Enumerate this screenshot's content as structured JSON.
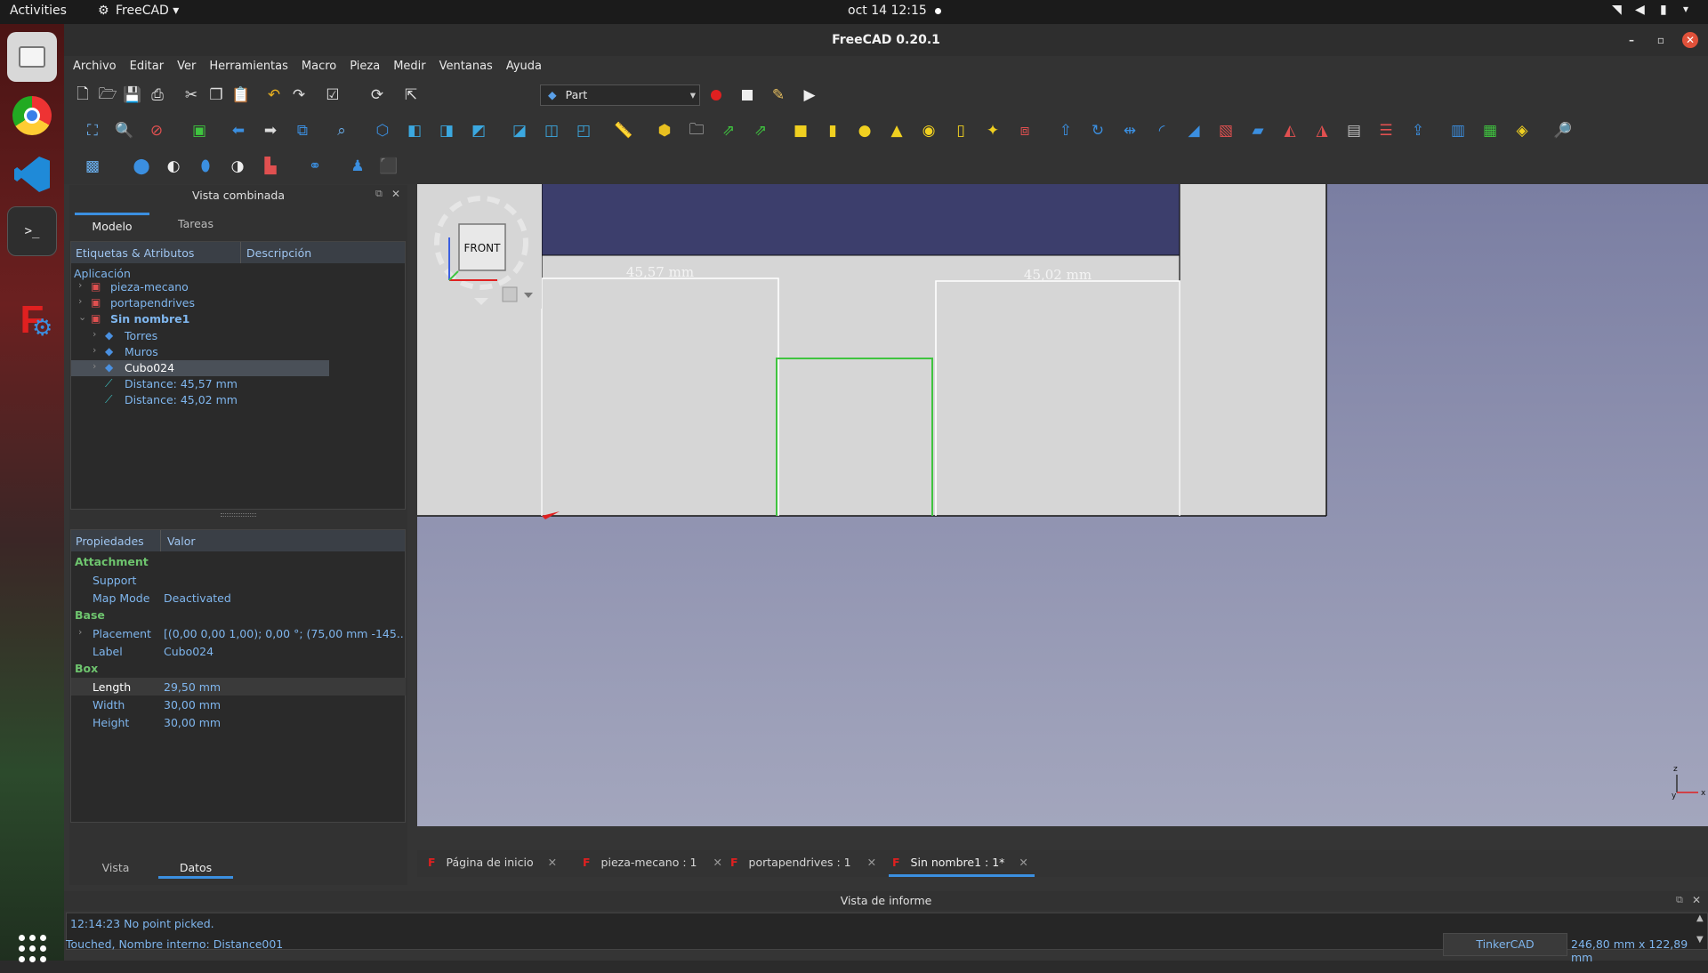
{
  "topbar": {
    "activities": "Activities",
    "app": "FreeCAD ▾",
    "clock": "oct 14  12:15"
  },
  "window": {
    "title": "FreeCAD 0.20.1"
  },
  "menu": [
    "Archivo",
    "Editar",
    "Ver",
    "Herramientas",
    "Macro",
    "Pieza",
    "Medir",
    "Ventanas",
    "Ayuda"
  ],
  "workbench": {
    "name": "Part"
  },
  "combo": {
    "title": "Vista combinada",
    "tabs": [
      "Modelo",
      "Tareas"
    ],
    "col1": "Etiquetas & Atributos",
    "col2": "Descripción",
    "root": "Aplicación"
  },
  "tree": [
    {
      "label": "pieza-mecano",
      "level": 1
    },
    {
      "label": "portapendrives",
      "level": 1
    },
    {
      "label": "Sin nombre1",
      "level": 1,
      "bold": true
    },
    {
      "label": "Torres",
      "level": 2
    },
    {
      "label": "Muros",
      "level": 2
    },
    {
      "label": "Cubo024",
      "level": 2,
      "selected": true
    },
    {
      "label": "Distance: 45,57 mm",
      "level": 2
    },
    {
      "label": "Distance: 45,02 mm",
      "level": 2
    }
  ],
  "props": {
    "col1": "Propiedades",
    "col2": "Valor",
    "groups": [
      {
        "name": "Attachment",
        "rows": [
          {
            "k": "Support",
            "v": ""
          },
          {
            "k": "Map Mode",
            "v": "Deactivated"
          }
        ]
      },
      {
        "name": "Base",
        "rows": [
          {
            "k": "Placement",
            "v": "[(0,00 0,00 1,00); 0,00 °; (75,00 mm  -145..."
          },
          {
            "k": "Label",
            "v": "Cubo024"
          }
        ]
      },
      {
        "name": "Box",
        "rows": [
          {
            "k": "Length",
            "v": "29,50 mm"
          },
          {
            "k": "Width",
            "v": "30,00 mm"
          },
          {
            "k": "Height",
            "v": "30,00 mm"
          }
        ]
      }
    ],
    "tabs": [
      "Vista",
      "Datos"
    ]
  },
  "viewport": {
    "navcube": "FRONT",
    "dim1": "45,57 mm",
    "dim2": "45,02 mm"
  },
  "doctabs": [
    "Página de inicio",
    "pieza-mecano : 1",
    "portapendrives : 1",
    "Sin nombre1 : 1*"
  ],
  "report": {
    "title": "Vista de informe",
    "line": "12:14:23  No point picked."
  },
  "status": {
    "left": "Touched, Nombre interno: Distance001",
    "nav": "TinkerCAD",
    "dims": "246,80 mm x 122,89 mm"
  },
  "colors": {
    "accent": "#3b8fe0",
    "selection": "#4a5058",
    "green": "#3fc43f",
    "red": "#e05050"
  }
}
